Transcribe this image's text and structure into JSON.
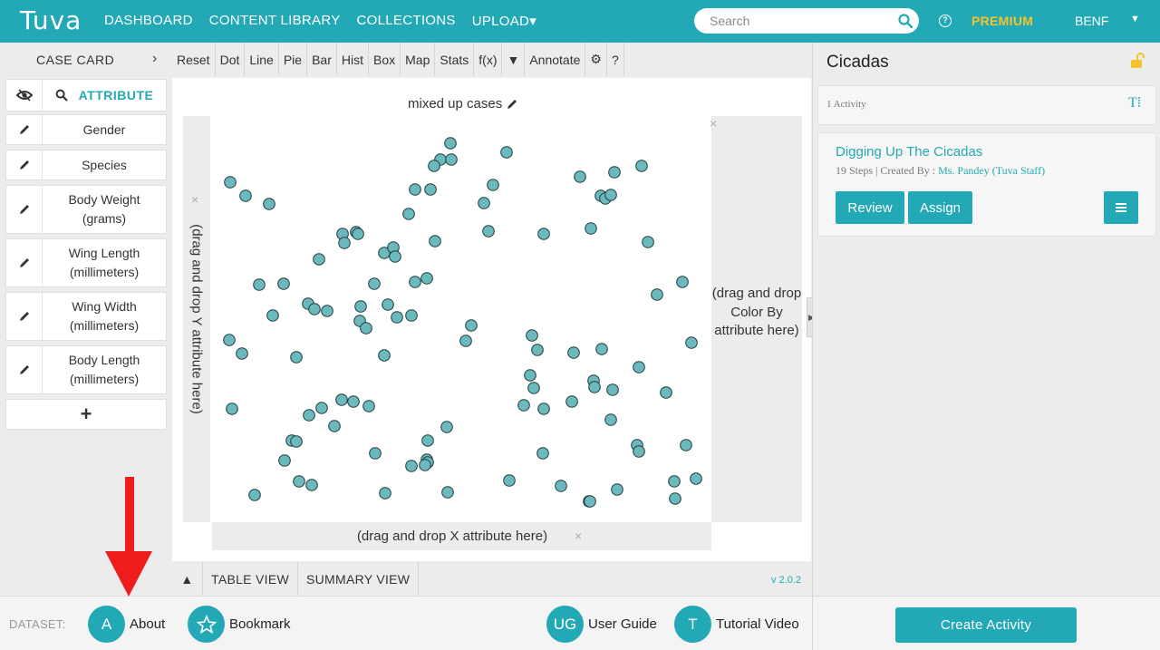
{
  "topbar": {
    "logo_text": "Tuva",
    "nav": [
      "DASHBOARD",
      "CONTENT LIBRARY",
      "COLLECTIONS",
      "UPLOAD▾"
    ],
    "search_placeholder": "Search",
    "premium": "PREMIUM",
    "user": "BENF",
    "user_caret": "▼",
    "help_glyph": "?"
  },
  "casecard": {
    "label": "CASE CARD",
    "chevron": "›",
    "attribute_header": "ATTRIBUTE",
    "attributes": [
      "Gender",
      "Species",
      "Body Weight (grams)",
      "Wing Length (millimeters)",
      "Wing Width (millimeters)",
      "Body Length (millimeters)"
    ],
    "add": "+"
  },
  "toolbar": {
    "buttons": [
      "Reset",
      "Dot",
      "Line",
      "Pie",
      "Bar",
      "Hist",
      "Box",
      "Map",
      "Stats",
      "f(x)",
      "▼",
      "Annotate",
      "⚙",
      "?"
    ]
  },
  "graph": {
    "title": "mixed up cases",
    "y_drop": "(drag and drop Y attribute here)",
    "x_drop": "(drag and drop X attribute here)",
    "color_drop": "(drag and drop Color By attribute here)",
    "close": "×",
    "point_color": "#6bb8bd"
  },
  "viewtabs": {
    "up": "▲",
    "table": "TABLE VIEW",
    "summary": "SUMMARY VIEW",
    "version": "v 2.0.2"
  },
  "footer": {
    "dataset_label": "DATASET:",
    "about_letter": "A",
    "about": "About",
    "bookmark": "Bookmark",
    "guide_letter": "UG",
    "guide": "User Guide",
    "tutorial_letter": "T",
    "tutorial": "Tutorial Video",
    "create": "Create Activity"
  },
  "rightpanel": {
    "title": "Cicadas",
    "activity_count": "1 Activity",
    "text_icon": "T⁞",
    "card_title": "Digging Up The Cicadas",
    "card_meta": "19 Steps | Created By : ",
    "card_author": "Ms. Pandey (Tuva Staff)",
    "review": "Review",
    "assign": "Assign"
  },
  "colors": {
    "brand": "#22a9b5",
    "premium": "#f5c32c",
    "annotation_arrow": "#ee1c1c"
  }
}
